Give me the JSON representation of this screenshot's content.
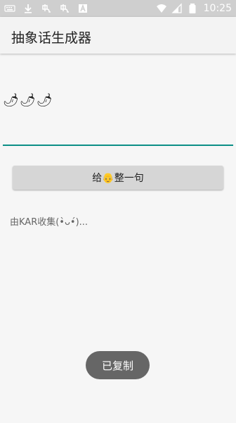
{
  "status_bar": {
    "time": "10:25",
    "left_icons": [
      "keyboard-icon",
      "download-icon",
      "app-icon-1",
      "app-icon-2",
      "text-a-icon"
    ],
    "right_icons": [
      "wifi-icon",
      "signal-icon",
      "battery-icon"
    ]
  },
  "app": {
    "title": "抽象话生成器"
  },
  "content": {
    "input_value": "🌶🌶🌶",
    "button_label": "给👴整一句",
    "credit_text": "由KAR收集(•̀ᴗ•́)..."
  },
  "toast": {
    "text": "已复制"
  },
  "colors": {
    "accent": "#0c8f86",
    "status_bar": "#cfcfcf",
    "toast_bg": "#666666"
  }
}
